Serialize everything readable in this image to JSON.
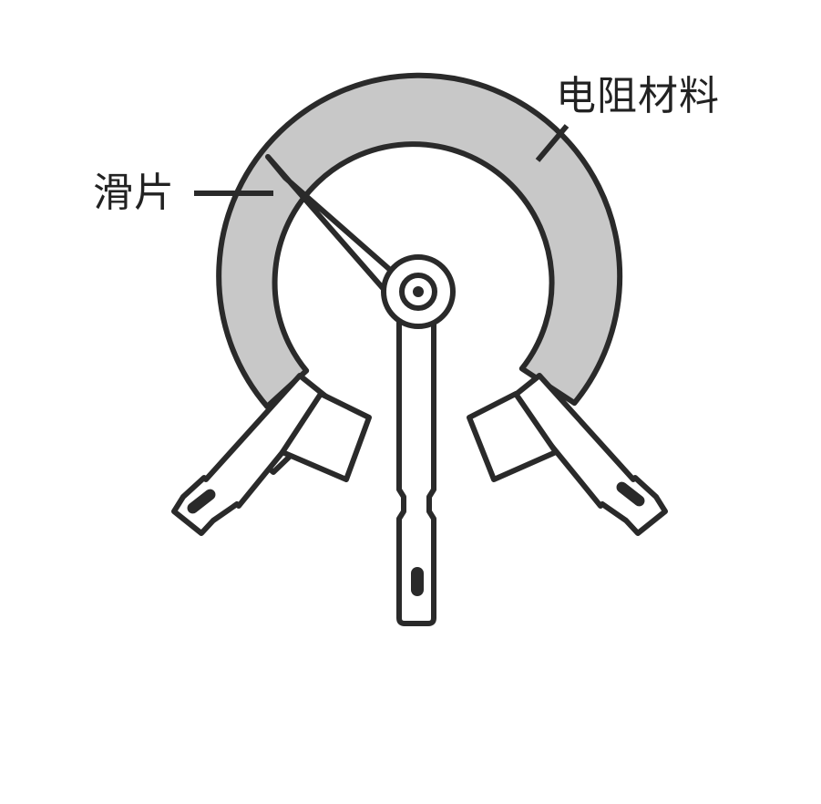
{
  "labels": {
    "slider": "滑片",
    "resistive_material": "电阻材料"
  },
  "colors": {
    "outline": "#2a2a2a",
    "resistive_fill": "#c8c8c8",
    "background": "#ffffff",
    "metal_fill": "#ffffff"
  }
}
